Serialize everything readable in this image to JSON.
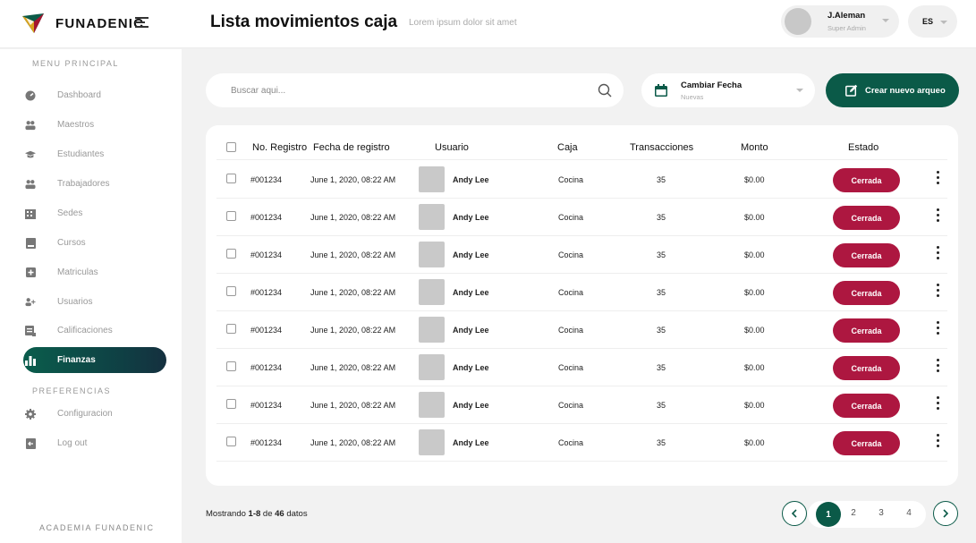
{
  "brand": {
    "name": "FUNADENIC",
    "accent": "#0b5a48",
    "status_color": "#ad1740"
  },
  "header": {
    "title": "Lista movimientos caja",
    "subtitle": "Lorem ipsum  dolor sit amet",
    "user": {
      "name": "J.Aleman",
      "role": "Super Admin"
    },
    "language": "ES"
  },
  "sidebar": {
    "main_title": "MENU PRINCIPAL",
    "items": [
      {
        "label": "Dashboard",
        "icon": "dashboard-icon"
      },
      {
        "label": "Maestros",
        "icon": "people-icon"
      },
      {
        "label": "Estudiantes",
        "icon": "graduation-cap-icon"
      },
      {
        "label": "Trabajadores",
        "icon": "people-icon"
      },
      {
        "label": "Sedes",
        "icon": "building-icon"
      },
      {
        "label": "Cursos",
        "icon": "book-icon"
      },
      {
        "label": "Matriculas",
        "icon": "plus-square-icon"
      },
      {
        "label": "Usuarios",
        "icon": "add-user-icon"
      },
      {
        "label": "Calificaciones",
        "icon": "grades-icon"
      },
      {
        "label": "Finanzas",
        "icon": "bar-chart-icon",
        "active": true
      }
    ],
    "pref_title": "PREFERENCIAS",
    "pref_items": [
      {
        "label": "Configuracion",
        "icon": "gear-icon"
      },
      {
        "label": "Log out",
        "icon": "logout-icon"
      }
    ],
    "footer": "ACADEMIA FUNADENIC"
  },
  "toolbar": {
    "search_placeholder": "Buscar aqui...",
    "date_label": "Cambiar Fecha",
    "date_sub": "Nuevas",
    "create_label": "Crear nuevo arqueo"
  },
  "table": {
    "headers": {
      "registro": "No. Registro",
      "fecha": "Fecha de registro",
      "usuario": "Usuario",
      "caja": "Caja",
      "transacciones": "Transacciones",
      "monto": "Monto",
      "estado": "Estado"
    },
    "rows": [
      {
        "registro": "#001234",
        "fecha": "June 1, 2020, 08:22 AM",
        "usuario": "Andy Lee",
        "caja": "Cocina",
        "transacciones": "35",
        "monto": "$0.00",
        "estado": "Cerrada"
      },
      {
        "registro": "#001234",
        "fecha": "June 1, 2020, 08:22 AM",
        "usuario": "Andy Lee",
        "caja": "Cocina",
        "transacciones": "35",
        "monto": "$0.00",
        "estado": "Cerrada"
      },
      {
        "registro": "#001234",
        "fecha": "June 1, 2020, 08:22 AM",
        "usuario": "Andy Lee",
        "caja": "Cocina",
        "transacciones": "35",
        "monto": "$0.00",
        "estado": "Cerrada"
      },
      {
        "registro": "#001234",
        "fecha": "June 1, 2020, 08:22 AM",
        "usuario": "Andy Lee",
        "caja": "Cocina",
        "transacciones": "35",
        "monto": "$0.00",
        "estado": "Cerrada"
      },
      {
        "registro": "#001234",
        "fecha": "June 1, 2020, 08:22 AM",
        "usuario": "Andy Lee",
        "caja": "Cocina",
        "transacciones": "35",
        "monto": "$0.00",
        "estado": "Cerrada"
      },
      {
        "registro": "#001234",
        "fecha": "June 1, 2020, 08:22 AM",
        "usuario": "Andy Lee",
        "caja": "Cocina",
        "transacciones": "35",
        "monto": "$0.00",
        "estado": "Cerrada"
      },
      {
        "registro": "#001234",
        "fecha": "June 1, 2020, 08:22 AM",
        "usuario": "Andy Lee",
        "caja": "Cocina",
        "transacciones": "35",
        "monto": "$0.00",
        "estado": "Cerrada"
      },
      {
        "registro": "#001234",
        "fecha": "June 1, 2020, 08:22 AM",
        "usuario": "Andy Lee",
        "caja": "Cocina",
        "transacciones": "35",
        "monto": "$0.00",
        "estado": "Cerrada"
      }
    ]
  },
  "footer": {
    "showing_prefix": "Mostrando ",
    "showing_range": "1-8",
    "showing_mid": " de ",
    "showing_total": "46",
    "showing_suffix": " datos",
    "pages": [
      "1",
      "2",
      "3",
      "4"
    ],
    "current_page": "1"
  }
}
